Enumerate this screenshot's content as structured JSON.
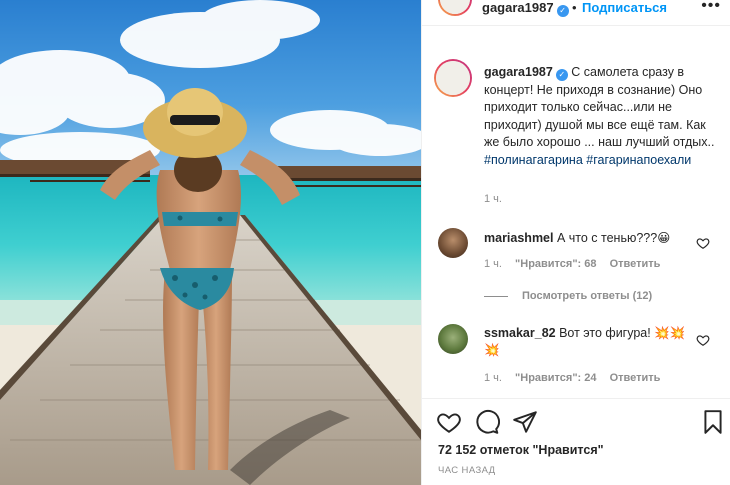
{
  "header": {
    "username": "gagara1987",
    "separator": "•",
    "follow_label": "Подписаться",
    "more_icon": "more-horizontal-icon"
  },
  "caption": {
    "username": "gagara1987",
    "text": "С самолета сразу в концерт! Не приходя в сознание) Оно приходит только сейчас...или не приходит) душой мы все ещё там. Как же было хорошо ... наш лучший отдых..",
    "hashtags": [
      "#полинагагарина",
      "#гагаринапоехали"
    ],
    "time": "1 ч."
  },
  "comments": [
    {
      "username": "mariashmel",
      "text": "А что с тенью???",
      "emoji": "😀",
      "time": "1 ч.",
      "likes": "\"Нравится\": 68",
      "reply_label": "Ответить"
    },
    {
      "username": "ssmakar_82",
      "text": "Вот это фигура!",
      "emoji": "💥💥💥",
      "time": "1 ч.",
      "likes": "\"Нравится\": 24",
      "reply_label": "Ответить"
    }
  ],
  "view_replies": "Посмотреть ответы (12)",
  "actions": {
    "likes_count": "72 152 отметок \"Нравится\"",
    "posted_ago": "час назад"
  },
  "colors": {
    "follow": "#0095f6",
    "hashtag": "#00376b",
    "muted": "#8e8e8e",
    "verified": "#3897f0"
  }
}
